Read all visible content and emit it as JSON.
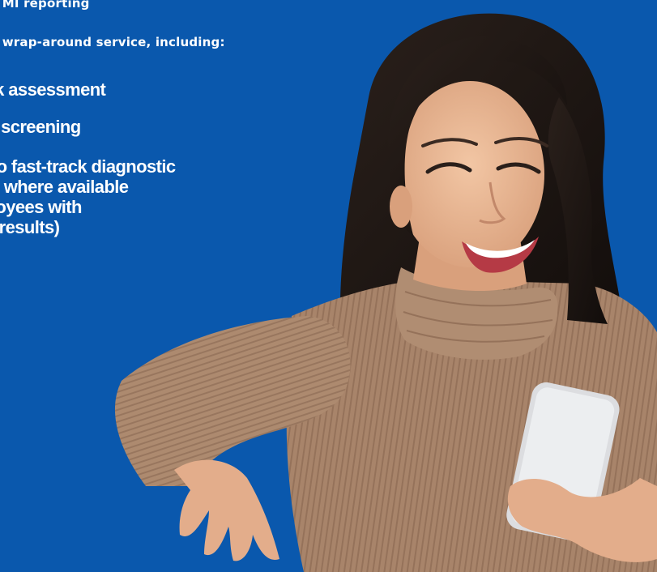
{
  "copy": {
    "intro_line_1": "ed MI reporting",
    "intro_line_2": "ed wrap-around service, including:",
    "bullets": [
      "isk assessment",
      " of screening",
      "nto fast-track diagnostic",
      "ys where available",
      "oloyees with",
      "al results)"
    ]
  },
  "photo": {
    "subject": "woman-smiling-at-phone",
    "background_color": "#0a58ad",
    "sweater_color": "#a8846a",
    "hair_color": "#1c1512",
    "skin_color": "#e9b896",
    "phone_color": "#e6e6e8"
  }
}
